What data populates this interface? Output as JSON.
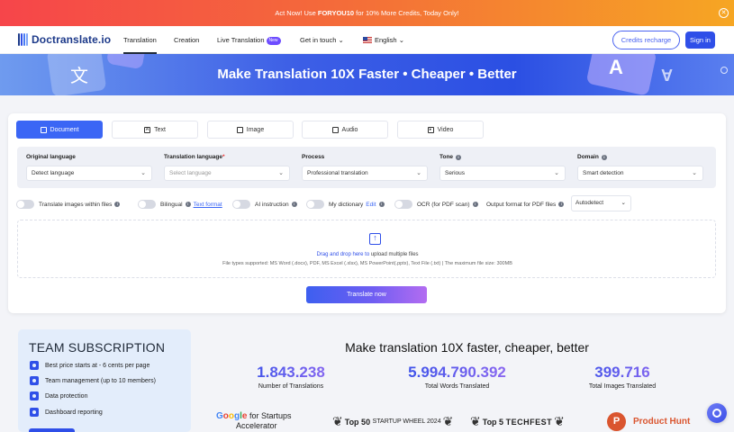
{
  "promo": {
    "prefix": "Act Now! Use ",
    "code": "FORYOU10",
    "suffix": " for 10% More Credits, Today Only!"
  },
  "nav": {
    "logo": "Doctranslate.io",
    "items": [
      "Translation",
      "Creation",
      "Live Translation",
      "Get in touch"
    ],
    "new_badge": "New",
    "language": "English",
    "credits_button": "Credits recharge",
    "signin_button": "Sign in"
  },
  "hero": {
    "title": "Make Translation 10X Faster • Cheaper • Better"
  },
  "tabs": [
    {
      "label": "Document",
      "icon": "document-icon",
      "active": true
    },
    {
      "label": "Text",
      "icon": "text-icon"
    },
    {
      "label": "Image",
      "icon": "image-icon"
    },
    {
      "label": "Audio",
      "icon": "audio-icon"
    },
    {
      "label": "Video",
      "icon": "video-icon"
    }
  ],
  "options": {
    "original_language": {
      "label": "Original language",
      "value": "Detect language"
    },
    "translation_language": {
      "label": "Translation language",
      "required": "*",
      "placeholder": "Select language"
    },
    "process": {
      "label": "Process",
      "value": "Professional translation"
    },
    "tone": {
      "label": "Tone",
      "value": "Serious"
    },
    "domain": {
      "label": "Domain",
      "value": "Smart detection"
    }
  },
  "toggles": {
    "translate_images": "Translate images within files",
    "bilingual": "Bilingual",
    "text_format": "Text format",
    "ai_instruction": "AI instruction",
    "my_dictionary": "My dictionary",
    "edit": "Edit",
    "ocr": "OCR (for PDF scan)",
    "output_format": "Output format for PDF files",
    "output_value": "Autodetect"
  },
  "dropzone": {
    "highlight": "Drag and drop here to",
    "text": " upload multiple files",
    "file_types": "File types supported: MS Word (.docx), PDF, MS Excel (.xlsx), MS PowerPoint(.pptx), Text File (.txt) | The maximum file size: 300MB"
  },
  "translate_button": "Translate now",
  "team": {
    "title": "TEAM SUBSCRIPTION",
    "items": [
      "Best price starts at - 6 cents per page",
      "Team management (up to 10 members)",
      "Data protection",
      "Dashboard reporting"
    ]
  },
  "stats": {
    "title": "Make translation 10X faster, cheaper, better",
    "items": [
      {
        "value": "1.843.238",
        "label": "Number of Translations"
      },
      {
        "value": "5.994.790.392",
        "label": "Total Words Translated"
      },
      {
        "value": "399.716",
        "label": "Total Images Translated"
      }
    ]
  },
  "badges": {
    "google": "Google",
    "google_rest": " for Startups",
    "accelerator": "Accelerator",
    "top50": "Top 50",
    "startup_wheel": "STARTUP WHEEL 2024",
    "top5": "Top 5",
    "techfest": "TECHFEST",
    "producthunt_letter": "P",
    "producthunt": "Product Hunt"
  }
}
